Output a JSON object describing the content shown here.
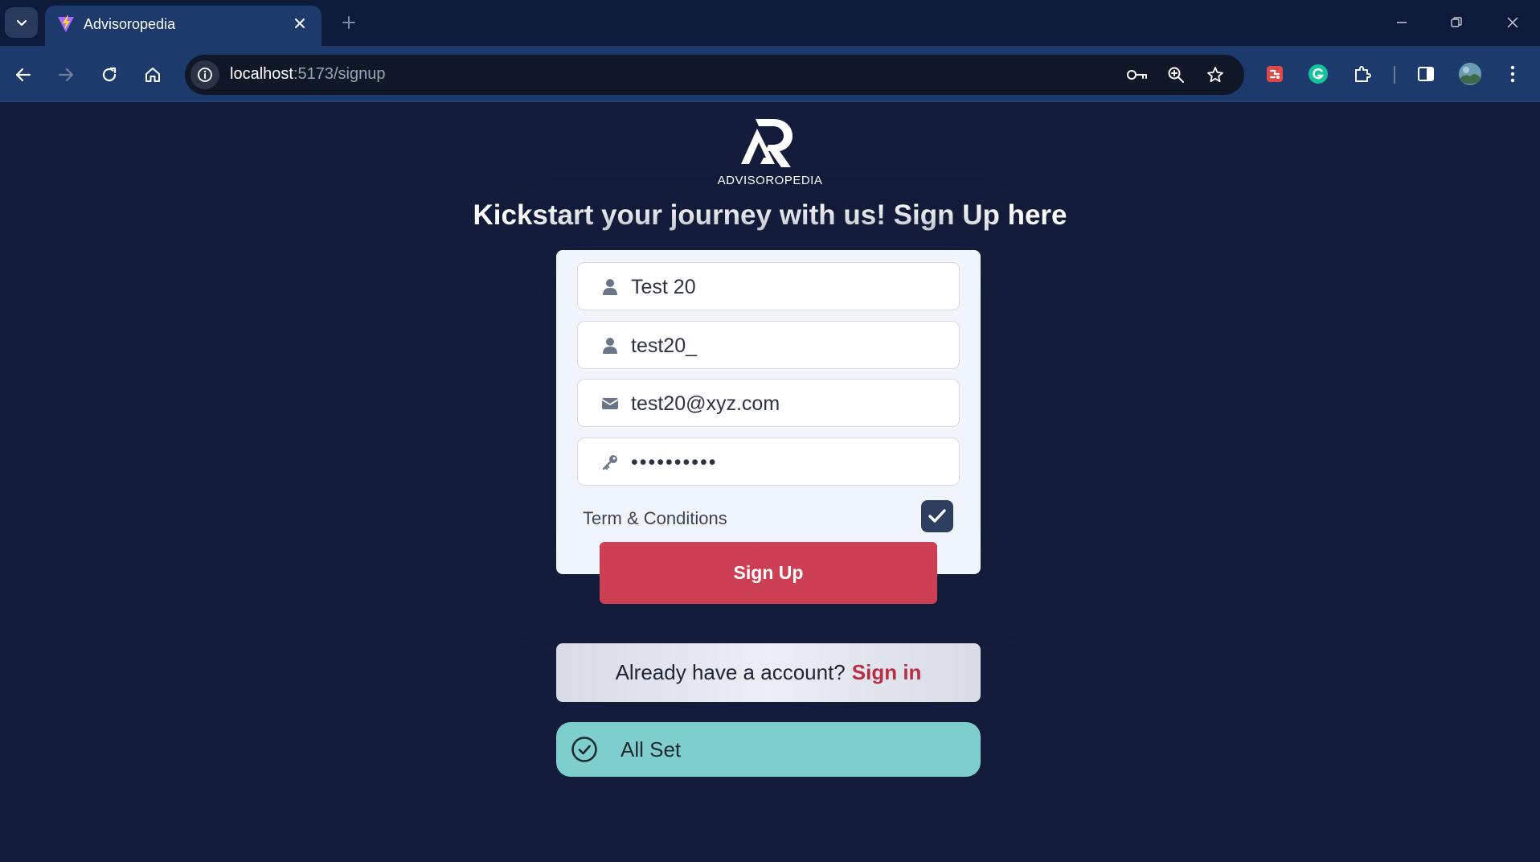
{
  "browser": {
    "tab": {
      "title": "Advisoropedia"
    },
    "address_bar": {
      "host": "localhost",
      "path": ":5173/signup"
    }
  },
  "page": {
    "brand": "ADVISOROPEDIA",
    "headline": "Kickstart your journey with us! Sign Up here",
    "form": {
      "full_name": "Test 20",
      "username": "test20_",
      "email": "test20@xyz.com",
      "password": "••••••••••",
      "terms_label": "Term & Conditions",
      "terms_checked": true,
      "submit_label": "Sign Up"
    },
    "signin": {
      "prompt": "Already have a account?",
      "link": "Sign in"
    },
    "toast": {
      "message": "All Set"
    }
  },
  "colors": {
    "page_background": "#131c3b",
    "card_background": "#f0f5fc",
    "primary_button": "#cd3f52",
    "link": "#b82f43",
    "toast": "#7ecece",
    "checkbox": "#2d3e5e"
  },
  "icons": [
    "chevron-down-icon",
    "vite-favicon-icon",
    "close-icon",
    "plus-icon",
    "minimize-icon",
    "restore-icon",
    "window-close-icon",
    "back-arrow-icon",
    "forward-arrow-icon",
    "reload-icon",
    "home-icon",
    "info-icon",
    "key-icon",
    "zoom-icon",
    "star-icon",
    "extension-red-icon",
    "grammarly-icon",
    "puzzle-icon",
    "sidepanel-icon",
    "profile-avatar-icon",
    "menu-dots-icon",
    "logo-icon",
    "user-icon",
    "email-icon",
    "password-key-icon",
    "check-icon",
    "check-circle-icon"
  ]
}
